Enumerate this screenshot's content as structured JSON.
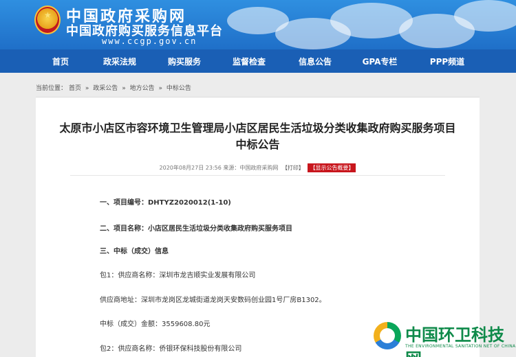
{
  "header": {
    "site_title": "中国政府采购网",
    "site_subtitle": "中国政府购买服务信息平台",
    "site_url": "www.ccgp.gov.cn"
  },
  "nav": [
    {
      "label": "首页"
    },
    {
      "label": "政采法规"
    },
    {
      "label": "购买服务"
    },
    {
      "label": "监督检查"
    },
    {
      "label": "信息公告"
    },
    {
      "label": "GPA专栏"
    },
    {
      "label": "PPP频道"
    }
  ],
  "breadcrumb": {
    "prefix": "当前位置：",
    "items": [
      "首页",
      "政采公告",
      "地方公告",
      "中标公告"
    ],
    "separator": "»"
  },
  "article": {
    "title_line1": "太原市小店区市容环境卫生管理局小店区居民生活垃圾分类收集政府购买服务项目",
    "title_line2": "中标公告",
    "meta_date": "2020年08月27日 23:56",
    "meta_source": "来源：中国政府采购网",
    "meta_print": "【打印】",
    "meta_summary": "【显示公告概要】",
    "lines": [
      "一、项目编号：DHTYZ2020012(1-10)",
      "二、项目名称：小店区居民生活垃圾分类收集政府购买服务项目",
      "三、中标（成交）信息",
      "包1：供应商名称：深圳市龙吉顺实业发展有限公司",
      "供应商地址：深圳市龙岗区龙城街道龙岗天安数码创业园1号厂房B1302。",
      "中标（成交）金额：3559608.80元",
      "包2：供应商名称：侨银环保科技股份有限公司"
    ]
  },
  "watermark": {
    "text": "中国环卫科技网",
    "subtext": "THE ENVIRONMENTAL SANITATION NET OF CHINA"
  },
  "colors": {
    "banner": "#1f6fc8",
    "nav": "#1a5fb5",
    "summary_button": "#c8161d",
    "watermark_green": "#0f8a4a"
  }
}
